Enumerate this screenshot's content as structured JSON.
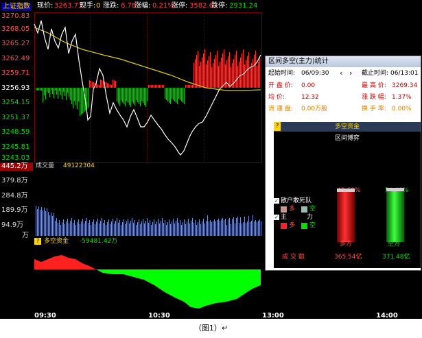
{
  "status": {
    "index_name": "上证指数",
    "now_label": "现价:",
    "now_value": "3263.71",
    "hand_label": "现手:",
    "hand_value": "0",
    "change_label": "涨跌:",
    "change_value": "6.78",
    "pct_label": "涨幅:",
    "pct_value": "0.21%",
    "limit_up_label": "涨停:",
    "limit_up_value": "3582.62",
    "limit_down_label": "跌停:",
    "limit_down_value": "2931.24"
  },
  "price_axis": [
    "3270.83",
    "3268.05",
    "3265.27",
    "3262.49",
    "3259.71",
    "3256.93",
    "3254.15",
    "3251.37",
    "3248.59",
    "3245.81",
    "3243.03"
  ],
  "volume": {
    "label": "成交量",
    "value": "49122304",
    "current_marker": "445.2万",
    "axis": [
      "379.8万",
      "284.8万",
      "189.9万",
      "94.9万",
      "万"
    ]
  },
  "fund": {
    "label": "多空资金",
    "value": "-59481.42万"
  },
  "time_axis": [
    "09:30",
    "10:30",
    "13:00",
    "14:00"
  ],
  "dialog": {
    "title": "区间多空(主力)统计",
    "start_label": "起始时间:",
    "start_value": "06/09:30",
    "end_label": "截止时间:",
    "end_value": "06/13:01",
    "open_label": "开 盘 价:",
    "open_value": "0.00",
    "high_label": "最 高 价:",
    "high_value": "3269.34",
    "avg_label": "均    价:",
    "avg_value": "12.32",
    "range_label": "涨 跌 幅:",
    "range_value": "1.37%",
    "float_label": "流 通 盘:",
    "float_value": "0.00万股",
    "turnover_label": "换 手 率:",
    "turnover_value": "0.00%",
    "fund_title": "多空资金",
    "section": "区间博弈",
    "retail_label": "散户敢死队",
    "retail_long": "多",
    "retail_short": "空",
    "main_label": "主",
    "main_label2": "力",
    "main_long": "多",
    "main_short": "空",
    "long_pct": "49.60%",
    "short_pct": "50.40%",
    "long_pct_value": 49.6,
    "short_pct_value": 50.4,
    "long_name": "多方",
    "short_name": "空方",
    "deal_label": "成  交  额",
    "long_amount": "365.54亿",
    "short_amount": "371.48亿"
  },
  "caption": "（图1）↵",
  "colors": {
    "up": "#ff3030",
    "down": "#00e000",
    "price_line": "#ffffff",
    "avg_line": "#e0d000",
    "axis_text": "#d8d8d8",
    "grid": "#7a0000",
    "label_yellow": "#ffd400",
    "volume_bar": "#6a9ad8"
  }
}
